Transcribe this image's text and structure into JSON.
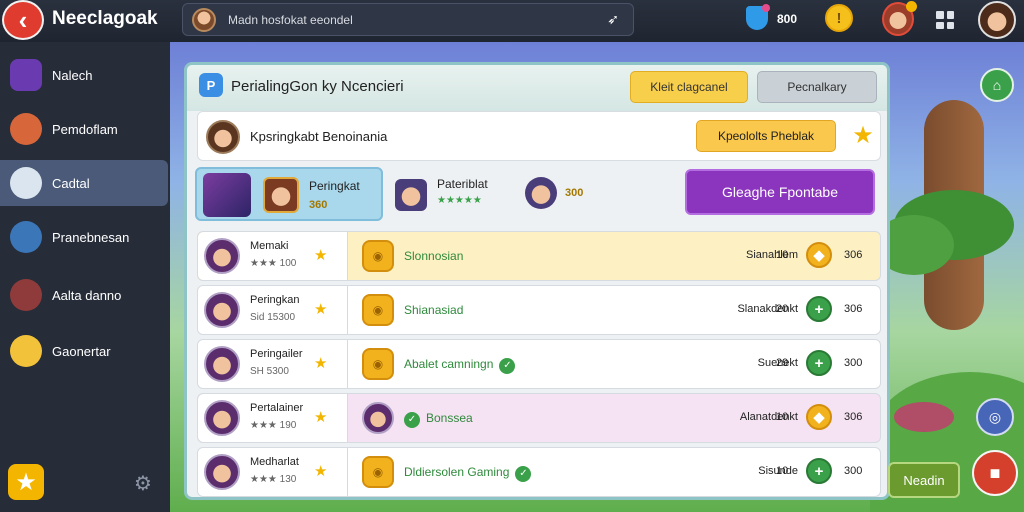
{
  "topbar": {
    "title": "Neeclagoak",
    "search_text": "Madn hosfokat eeondel",
    "gem_count": "800",
    "coin_symbol": "!"
  },
  "sidebar": {
    "items": [
      {
        "label": "Nalech",
        "icon": "book-icon",
        "color": "#6a3bb0"
      },
      {
        "label": "Pemdoflam",
        "icon": "character-icon",
        "color": "#d7663b"
      },
      {
        "label": "Cadtal",
        "icon": "cloud-icon",
        "color": "#dbe5ef"
      },
      {
        "label": "Pranebnesan",
        "icon": "character-icon",
        "color": "#3b77b8"
      },
      {
        "label": "Aalta danno",
        "icon": "character-icon",
        "color": "#8f3b3b"
      },
      {
        "label": "Gaonertar",
        "icon": "character-icon",
        "color": "#f2c23a"
      }
    ]
  },
  "panel": {
    "header_icon": "P",
    "title": "PerialingGon ky Ncencieri",
    "btn_yellow": "Kleit clagcanel",
    "btn_grey": "Pecnalkary",
    "event": {
      "label": "Kpsringkabt Benoinania",
      "btn": "Kpeololts Pheblak"
    },
    "hero": {
      "name": "Peringkat",
      "points": "360"
    },
    "mid": {
      "name": "Pateriblat",
      "stars": "★★★★★"
    },
    "mid2_points": "300",
    "purple_btn": "Gleaghe Fpontabe",
    "rows": [
      {
        "name": "Memaki",
        "sub": "★★★ 100",
        "badge": "",
        "task": "Slonnosian",
        "task_check": false,
        "stat": "Sianahlem",
        "num": "10",
        "action": "gold",
        "score": "306",
        "bg": "#fdf1c4"
      },
      {
        "name": "Peringkan",
        "sub": "Sid 15300",
        "badge": "",
        "task": "Shianasiad",
        "task_check": false,
        "stat": "Slanakdenkt",
        "num": "20",
        "action": "green",
        "score": "306",
        "bg": "#ffffff"
      },
      {
        "name": "Peringailer",
        "sub": "SH 5300",
        "badge": "",
        "task": "Abalet camningn",
        "task_check": true,
        "stat": "Suenekt",
        "num": "29",
        "action": "green",
        "score": "300",
        "bg": "#ffffff"
      },
      {
        "name": "Pertalainer",
        "sub": "★★★ 190",
        "badge": "",
        "task": "Bonssea",
        "task_check": false,
        "stat": "Alanatdenkt",
        "num": "10",
        "action": "gold",
        "score": "306",
        "bg": "#f5e2f2"
      },
      {
        "name": "Medharlat",
        "sub": "★★★ 130",
        "badge": "",
        "task": "Dldiersolen Gaming",
        "task_check": true,
        "stat": "Sisunde",
        "num": "10",
        "action": "green",
        "score": "300",
        "bg": "#ffffff"
      }
    ]
  },
  "bottom": {
    "green_btn": "Neadin"
  }
}
